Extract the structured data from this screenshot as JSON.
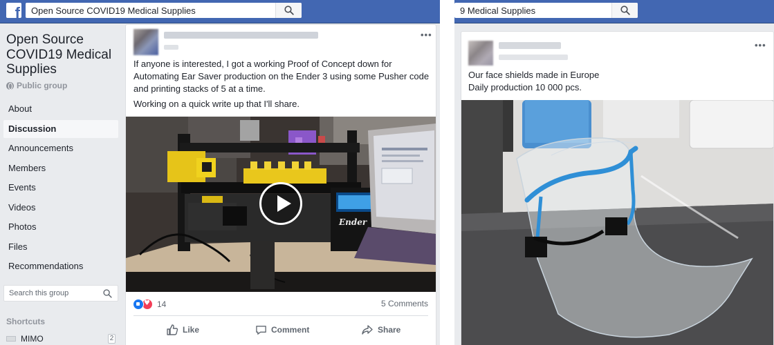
{
  "left": {
    "logo_letter": "f",
    "search": {
      "value": "Open Source COVID19 Medical Supplies"
    },
    "group": {
      "name": "Open Source COVID19 Medical Supplies",
      "privacy": "Public group"
    },
    "nav": [
      {
        "label": "About"
      },
      {
        "label": "Discussion",
        "active": true
      },
      {
        "label": "Announcements"
      },
      {
        "label": "Members"
      },
      {
        "label": "Events"
      },
      {
        "label": "Videos"
      },
      {
        "label": "Photos"
      },
      {
        "label": "Files"
      },
      {
        "label": "Recommendations"
      }
    ],
    "group_search": {
      "placeholder": "Search this group"
    },
    "shortcuts": {
      "title": "Shortcuts",
      "items": [
        {
          "label": "MIMO",
          "count": "2"
        }
      ]
    },
    "post": {
      "more": "•••",
      "paragraph1": "If anyone is interested, I got a working Proof of Concept down for Automating Ear Saver production on the Ender 3 using some Pusher code and printing stacks of 5 at a time.",
      "paragraph2": "Working on a quick write up that I'll share.",
      "printer_brand": "Ender",
      "reactions": {
        "types": [
          "like",
          "love"
        ],
        "count": "14"
      },
      "comments": "5 Comments",
      "actions": {
        "like": "Like",
        "comment": "Comment",
        "share": "Share"
      }
    }
  },
  "right": {
    "search": {
      "value": "9 Medical Supplies"
    },
    "post": {
      "more": "•••",
      "line1": "Our face shields made in Europe",
      "line2": "Daily production 10 000 pcs."
    }
  },
  "colors": {
    "brand_blue": "#4267b2",
    "page_bg": "#e9ebee",
    "text": "#1d2129",
    "secondary_text": "#606770",
    "like_blue": "#1877f2",
    "love_red": "#f33e58",
    "face_shield_frame": "#2f8fd6"
  },
  "icons": [
    "facebook-logo-icon",
    "search-icon",
    "globe-icon",
    "play-icon",
    "like-icon",
    "comment-icon",
    "share-icon",
    "more-options-icon"
  ]
}
